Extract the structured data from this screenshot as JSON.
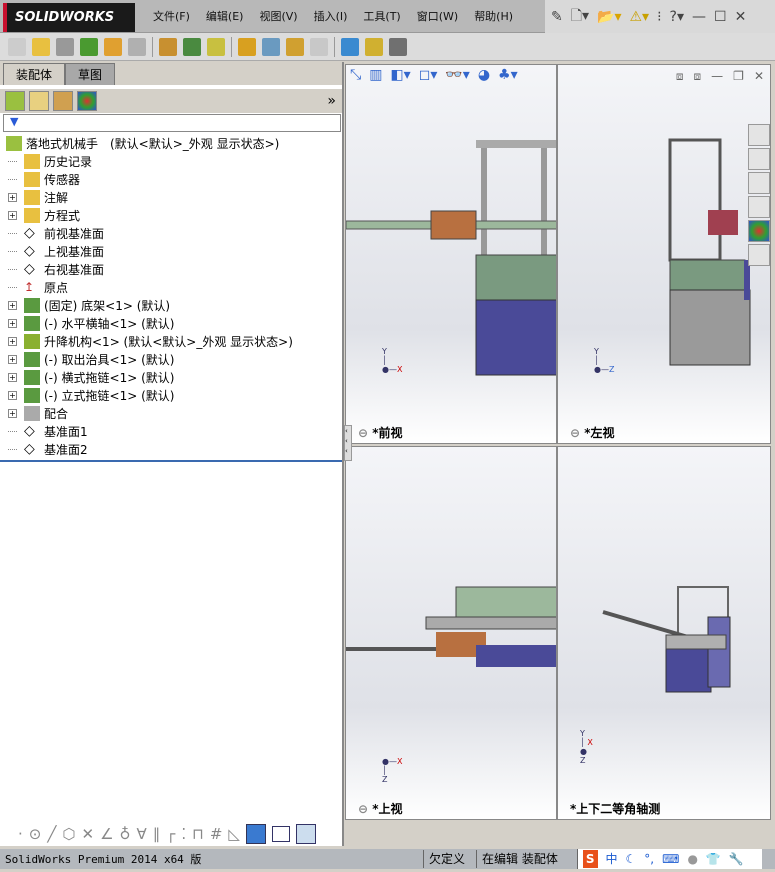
{
  "app": {
    "logo": "SOLIDWORKS",
    "accent": "#c8102e"
  },
  "menus": [
    "文件(F)",
    "编辑(E)",
    "视图(V)",
    "插入(I)",
    "工具(T)",
    "窗口(W)",
    "帮助(H)"
  ],
  "tabs": [
    "装配体",
    "草图"
  ],
  "tree": [
    {
      "label": "落地式机械手　(默认<默认>_外观 显示状态>)",
      "icon": "assembly-icon",
      "expand": false,
      "indent": 0
    },
    {
      "label": "历史记录",
      "icon": "history-icon",
      "expand": false,
      "indent": 1
    },
    {
      "label": "传感器",
      "icon": "sensor-icon",
      "expand": false,
      "indent": 1
    },
    {
      "label": "注解",
      "icon": "annotation-icon",
      "expand": true,
      "indent": 1
    },
    {
      "label": "方程式",
      "icon": "equation-icon",
      "expand": true,
      "indent": 1
    },
    {
      "label": "前视基准面",
      "icon": "plane-icon",
      "expand": false,
      "indent": 1
    },
    {
      "label": "上视基准面",
      "icon": "plane-icon",
      "expand": false,
      "indent": 1
    },
    {
      "label": "右视基准面",
      "icon": "plane-icon",
      "expand": false,
      "indent": 1
    },
    {
      "label": "原点",
      "icon": "origin-icon",
      "expand": false,
      "indent": 1
    },
    {
      "label": "(固定) 底架<1> (默认)",
      "icon": "part-icon",
      "expand": true,
      "indent": 1
    },
    {
      "label": "(-) 水平横轴<1> (默认)",
      "icon": "part-icon",
      "expand": true,
      "indent": 1
    },
    {
      "label": "升降机构<1> (默认<默认>_外观 显示状态>)",
      "icon": "subassembly-icon",
      "expand": true,
      "indent": 1
    },
    {
      "label": "(-) 取出治具<1> (默认)",
      "icon": "part-icon",
      "expand": true,
      "indent": 1
    },
    {
      "label": "(-) 横式拖链<1> (默认)",
      "icon": "part-icon",
      "expand": true,
      "indent": 1
    },
    {
      "label": "(-) 立式拖链<1> (默认)",
      "icon": "part-icon",
      "expand": true,
      "indent": 1
    },
    {
      "label": "配合",
      "icon": "mates-icon",
      "expand": true,
      "indent": 1
    },
    {
      "label": "基准面1",
      "icon": "plane-icon",
      "expand": false,
      "indent": 1
    },
    {
      "label": "基准面2",
      "icon": "plane-icon",
      "expand": false,
      "indent": 1
    }
  ],
  "viewports": [
    {
      "label": "*前视",
      "axes": [
        "Y",
        "X"
      ]
    },
    {
      "label": "*左视",
      "axes": [
        "Y",
        "Z"
      ]
    },
    {
      "label": "*上视",
      "axes": [
        "Z",
        "X"
      ]
    },
    {
      "label": "*上下二等角轴测",
      "axes": [
        "Y",
        "X",
        "Z"
      ]
    }
  ],
  "status": {
    "product": "SolidWorks Premium 2014 x64 版",
    "state": "欠定义",
    "mode": "在编辑 装配体",
    "ime": "中"
  }
}
